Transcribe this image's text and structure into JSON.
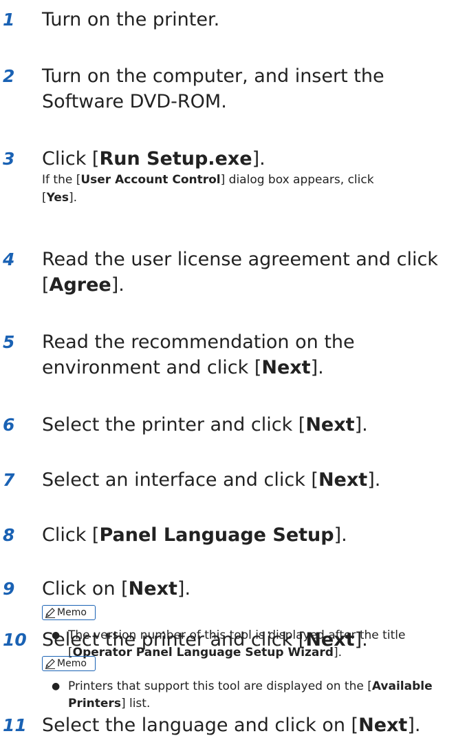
{
  "steps": [
    {
      "num": "1",
      "parts": [
        "Turn on the printer."
      ]
    },
    {
      "num": "2",
      "parts": [
        "Turn on the computer, and insert the Software DVD-ROM."
      ]
    },
    {
      "num": "3",
      "parts": [
        "Click [",
        "Run Setup.exe",
        "]."
      ],
      "note": [
        "If the [",
        "User Account Control",
        "] dialog box appears, click [",
        "Yes",
        "]."
      ]
    },
    {
      "num": "4",
      "parts": [
        "Read the user license agreement and click [",
        "Agree",
        "]."
      ]
    },
    {
      "num": "5",
      "parts": [
        "Read the recommendation on the environment and click [",
        "Next",
        "]."
      ]
    },
    {
      "num": "6",
      "parts": [
        "Select the printer and click [",
        "Next",
        "]."
      ]
    },
    {
      "num": "7",
      "parts": [
        "Select an interface and click [",
        "Next",
        "]."
      ]
    },
    {
      "num": "8",
      "parts": [
        "Click [",
        "Panel Language Setup",
        "]."
      ]
    },
    {
      "num": "9",
      "parts": [
        "Click on [",
        "Next",
        "]."
      ],
      "memo": "Memo",
      "bullet": [
        "The version number of this tool is displayed after the title [",
        "Operator Panel Language Setup Wizard",
        "]."
      ]
    },
    {
      "num": "10",
      "parts": [
        "Select the printer and click [",
        "Next",
        "]."
      ],
      "memo": "Memo",
      "bullet": [
        "Printers that support this tool are displayed on the [",
        "Available Printers",
        "] list."
      ]
    },
    {
      "num": "11",
      "parts": [
        "Select the language and click on [",
        "Next",
        "]."
      ]
    }
  ],
  "colors": {
    "accent": "#1a62b4",
    "text": "#222222"
  }
}
